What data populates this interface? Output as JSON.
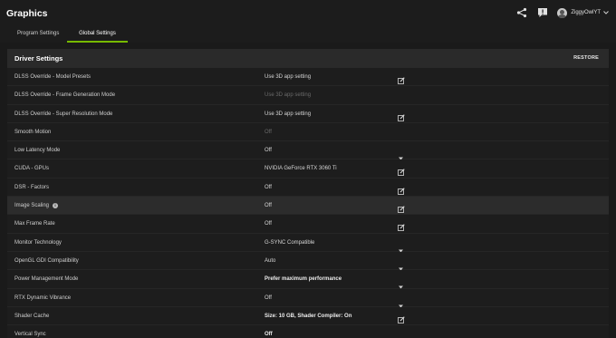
{
  "app": {
    "title": "Graphics",
    "username": "ZiggyOwlYT"
  },
  "tabs": [
    {
      "label": "Program Settings",
      "active": false
    },
    {
      "label": "Global Settings",
      "active": true
    }
  ],
  "section": {
    "title": "Driver Settings",
    "restore_label": "RESTORE"
  },
  "rows": [
    {
      "label": "DLSS Override - Model Presets",
      "value": "Use 3D app setting",
      "state": "normal",
      "control": "edit-icon"
    },
    {
      "label": "DLSS Override - Frame Generation Mode",
      "value": "Use 3D app setting",
      "state": "disabled",
      "control": "none"
    },
    {
      "label": "DLSS Override - Super Resolution Mode",
      "value": "Use 3D app setting",
      "state": "normal",
      "control": "edit-icon"
    },
    {
      "label": "Smooth Motion",
      "value": "Off",
      "state": "disabled",
      "control": "none"
    },
    {
      "label": "Low Latency Mode",
      "value": "Off",
      "state": "normal",
      "control": "chevron-down-icon"
    },
    {
      "label": "CUDA - GPUs",
      "value": "NVIDIA GeForce RTX 3060 Ti",
      "state": "normal",
      "control": "edit-icon"
    },
    {
      "label": "DSR - Factors",
      "value": "Off",
      "state": "normal",
      "control": "edit-icon"
    },
    {
      "label": "Image Scaling",
      "value": "Off",
      "state": "normal",
      "control": "edit-icon",
      "info": true,
      "highlight": true
    },
    {
      "label": "Max Frame Rate",
      "value": "Off",
      "state": "normal",
      "control": "edit-icon"
    },
    {
      "label": "Monitor Technology",
      "value": "G-SYNC Compatible",
      "state": "normal",
      "control": "chevron-down-icon"
    },
    {
      "label": "OpenGL GDI Compatibility",
      "value": "Auto",
      "state": "normal",
      "control": "chevron-down-icon"
    },
    {
      "label": "Power Management Mode",
      "value": "Prefer maximum performance",
      "state": "bold",
      "control": "chevron-down-icon"
    },
    {
      "label": "RTX Dynamic Vibrance",
      "value": "Off",
      "state": "normal",
      "control": "chevron-down-icon"
    },
    {
      "label": "Shader Cache",
      "value": "Size: 10 GB, Shader Compiler: On",
      "state": "bold",
      "control": "edit-icon"
    },
    {
      "label": "Vertical Sync",
      "value": "Off",
      "state": "bold",
      "control": "chevron-down-icon"
    }
  ],
  "colors": {
    "accent": "#76b900",
    "background": "#1a1a1a",
    "row": "#1d1d1d",
    "header": "#2a2a2a"
  }
}
